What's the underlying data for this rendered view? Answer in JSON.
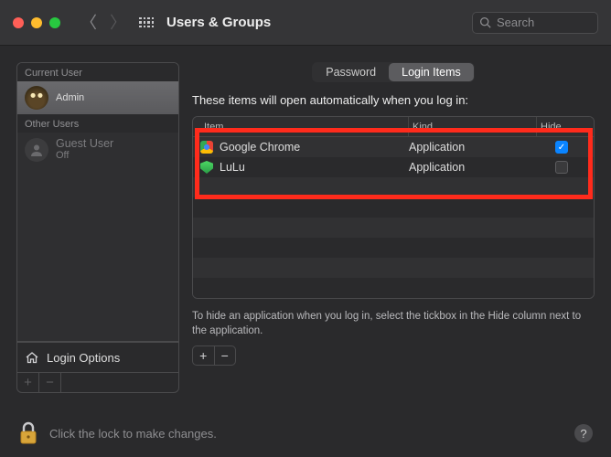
{
  "window": {
    "title": "Users & Groups",
    "search_placeholder": "Search"
  },
  "sidebar": {
    "current_user_label": "Current User",
    "other_users_label": "Other Users",
    "current": {
      "name": "",
      "role": "Admin"
    },
    "others": [
      {
        "name": "Guest User",
        "status": "Off"
      }
    ],
    "login_options_label": "Login Options"
  },
  "tabs": {
    "password": "Password",
    "login_items": "Login Items"
  },
  "main": {
    "intro": "These items will open automatically when you log in:",
    "columns": {
      "item": "Item",
      "kind": "Kind",
      "hide": "Hide"
    },
    "items": [
      {
        "icon": "chrome",
        "name": "Google Chrome",
        "kind": "Application",
        "hide": true
      },
      {
        "icon": "lulu",
        "name": "LuLu",
        "kind": "Application",
        "hide": false
      }
    ],
    "hint": "To hide an application when you log in, select the tickbox in the Hide column next to the application."
  },
  "footer": {
    "lock_text": "Click the lock to make changes."
  }
}
